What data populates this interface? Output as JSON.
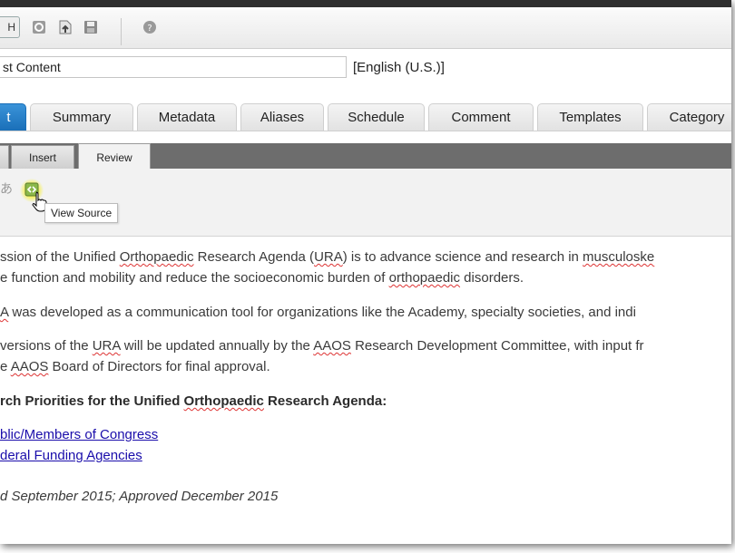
{
  "toolbar": {
    "first_button_label": "H",
    "icons": [
      "checkin-icon",
      "upload-icon",
      "save-icon",
      "help-icon"
    ]
  },
  "title_field": {
    "value": "st Content",
    "language": "[English (U.S.)]"
  },
  "tabs": [
    {
      "label": "t"
    },
    {
      "label": "Summary"
    },
    {
      "label": "Metadata"
    },
    {
      "label": "Aliases"
    },
    {
      "label": "Schedule"
    },
    {
      "label": "Comment"
    },
    {
      "label": "Templates"
    },
    {
      "label": "Category"
    }
  ],
  "ribbon": {
    "tabs": [
      {
        "label": "Insert"
      },
      {
        "label": "Review"
      }
    ],
    "tooltip": "View Source"
  },
  "content": {
    "p1": [
      {
        "t": "ssion of the Unified "
      },
      {
        "t": "Orthopaedic",
        "s": true
      },
      {
        "t": " Research Agenda ("
      },
      {
        "t": "URA",
        "s": true
      },
      {
        "t": ") is to advance science and research in "
      },
      {
        "t": "musculoske",
        "s": true
      }
    ],
    "p1b": [
      {
        "t": "e function and mobility and reduce the socioeconomic burden of "
      },
      {
        "t": "orthopaedic",
        "s": true
      },
      {
        "t": " disorders."
      }
    ],
    "p2": [
      {
        "t": "A",
        "s": true
      },
      {
        "t": " was developed as a communication tool for organizations like the Academy, specialty societies, and indi"
      }
    ],
    "p3": [
      {
        "t": "versions of the "
      },
      {
        "t": "URA",
        "s": true
      },
      {
        "t": " will be updated annually by the "
      },
      {
        "t": "AAOS",
        "s": true
      },
      {
        "t": " Research Development Committee, with input fr"
      }
    ],
    "p3b": [
      {
        "t": "e "
      },
      {
        "t": "AAOS",
        "s": true
      },
      {
        "t": " Board of Directors for final approval."
      }
    ],
    "heading": [
      {
        "t": "rch Priorities for the Unified "
      },
      {
        "t": "Orthopaedic",
        "s": true
      },
      {
        "t": " Research Agenda:"
      }
    ],
    "link1": "blic/Members of Congress",
    "link2": "deral Funding Agencies",
    "footer": "d September 2015; Approved December 2015"
  }
}
